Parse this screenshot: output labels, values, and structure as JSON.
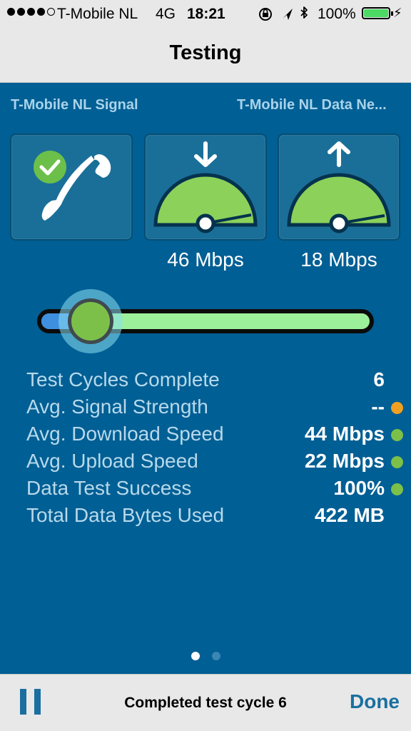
{
  "status_bar": {
    "carrier": "T-Mobile NL",
    "network_type": "4G",
    "time": "18:21",
    "battery_percent": "100%",
    "signal_bars_filled": 4,
    "signal_bars_total": 5,
    "icons": [
      "orientation-lock-icon",
      "location-arrow-icon",
      "bluetooth-icon",
      "battery-icon",
      "charging-bolt-icon"
    ]
  },
  "nav": {
    "title": "Testing"
  },
  "networks": {
    "signal_label": "T-Mobile NL Signal",
    "data_label": "T-Mobile NL Data Ne..."
  },
  "tiles": {
    "call": {
      "icon": "phone-icon",
      "status_icon": "check-circle-icon",
      "status_color": "#6cc04a"
    },
    "download": {
      "icon": "down-arrow-icon",
      "gauge_icon": "speedometer-icon",
      "speed": "46 Mbps"
    },
    "upload": {
      "icon": "up-arrow-icon",
      "gauge_icon": "speedometer-icon",
      "speed": "18 Mbps"
    }
  },
  "progress": {
    "fraction": 0.15
  },
  "stats": [
    {
      "label": "Test Cycles Complete",
      "value": "6",
      "indicator": null
    },
    {
      "label": "Avg. Signal Strength",
      "value": "--",
      "indicator": "#f0a020"
    },
    {
      "label": "Avg. Download Speed",
      "value": "44 Mbps",
      "indicator": "#7cc04a"
    },
    {
      "label": "Avg. Upload Speed",
      "value": "22 Mbps",
      "indicator": "#7cc04a"
    },
    {
      "label": "Data Test Success",
      "value": "100%",
      "indicator": "#7cc04a"
    },
    {
      "label": "Total Data Bytes Used",
      "value": "422 MB",
      "indicator": null
    }
  ],
  "pager": {
    "pages": 2,
    "current": 1
  },
  "toolbar": {
    "pause_icon": "pause-icon",
    "status_text": "Completed test cycle 6",
    "done_label": "Done"
  },
  "colors": {
    "background": "#005f94",
    "accent": "#1a6fa0",
    "gauge_green": "#8cd15a"
  }
}
